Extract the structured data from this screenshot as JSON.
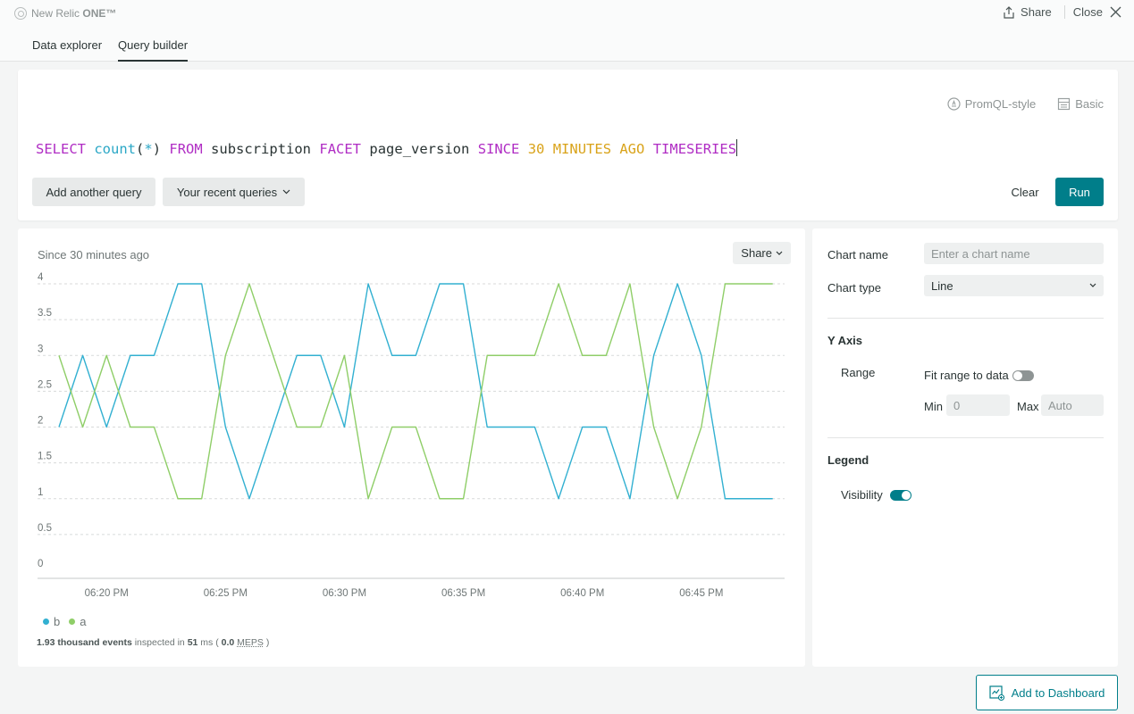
{
  "app": {
    "title": "New Relic ONE™",
    "title_plain": "New Relic ",
    "title_bold": "ONE™"
  },
  "top_actions": {
    "share": "Share",
    "close": "Close"
  },
  "tabs": [
    {
      "label": "Data explorer",
      "active": false
    },
    {
      "label": "Query builder",
      "active": true
    }
  ],
  "query": {
    "modes": [
      {
        "label": "PromQL-style",
        "icon": "promql-icon"
      },
      {
        "label": "Basic",
        "icon": "basic-icon"
      }
    ],
    "tokens": [
      {
        "text": "SELECT",
        "type": "kw"
      },
      {
        "text": " ",
        "type": "plain"
      },
      {
        "text": "count",
        "type": "fn"
      },
      {
        "text": "(",
        "type": "plain"
      },
      {
        "text": "*",
        "type": "fn"
      },
      {
        "text": ") ",
        "type": "plain"
      },
      {
        "text": "FROM",
        "type": "kw"
      },
      {
        "text": " subscription ",
        "type": "plain"
      },
      {
        "text": "FACET",
        "type": "kw"
      },
      {
        "text": " page_version ",
        "type": "plain"
      },
      {
        "text": "SINCE",
        "type": "kw"
      },
      {
        "text": " ",
        "type": "plain"
      },
      {
        "text": "30 MINUTES AGO",
        "type": "num"
      },
      {
        "text": " ",
        "type": "plain"
      },
      {
        "text": "TIMESERIES",
        "type": "kw"
      }
    ],
    "add_another": "Add another query",
    "recent": "Your recent queries",
    "clear": "Clear",
    "run": "Run"
  },
  "chart_panel": {
    "since_label": "Since 30 minutes ago",
    "share": "Share",
    "stats": {
      "count": "1.93 thousand events",
      "inspected_in": "inspected in",
      "ms": "51",
      "ms_unit": "ms (",
      "meps_val": "0.0",
      "meps": "MEPS",
      "close_paren": ")"
    }
  },
  "chart_data": {
    "type": "line",
    "title": "",
    "xlabel": "",
    "ylabel": "",
    "ylim": [
      0,
      4
    ],
    "y_ticks": [
      "0",
      "0.5",
      "1",
      "1.5",
      "2",
      "2.5",
      "3",
      "3.5",
      "4"
    ],
    "x_ticks": [
      "06:20 PM",
      "06:25 PM",
      "06:30 PM",
      "06:35 PM",
      "06:40 PM",
      "06:45 PM"
    ],
    "x_start_minute": 18,
    "x_end_minute": 48.5,
    "x_labels": [
      "06:18",
      "06:19",
      "06:20",
      "06:21",
      "06:22",
      "06:23",
      "06:24",
      "06:25",
      "06:26",
      "06:27",
      "06:28",
      "06:29",
      "06:30",
      "06:31",
      "06:32",
      "06:33",
      "06:34",
      "06:35",
      "06:36",
      "06:37",
      "06:38",
      "06:39",
      "06:40",
      "06:41",
      "06:42",
      "06:43",
      "06:44",
      "06:45",
      "06:46",
      "06:47",
      "06:48"
    ],
    "grid": true,
    "legend_position": "bottom-left",
    "series": [
      {
        "name": "b",
        "color": "#32b0d1",
        "values": [
          2,
          3,
          2,
          3,
          3,
          4,
          4,
          2,
          1,
          2,
          3,
          3,
          2,
          4,
          3,
          3,
          4,
          4,
          2,
          2,
          2,
          1,
          2,
          2,
          1,
          3,
          4,
          3,
          1,
          1,
          1
        ]
      },
      {
        "name": "a",
        "color": "#8fce68",
        "values": [
          3,
          2,
          3,
          2,
          2,
          1,
          1,
          3,
          4,
          3,
          2,
          2,
          3,
          1,
          2,
          2,
          1,
          1,
          3,
          3,
          3,
          4,
          3,
          3,
          4,
          2,
          1,
          2,
          4,
          4,
          4
        ]
      }
    ]
  },
  "settings": {
    "chart_name_label": "Chart name",
    "chart_name_placeholder": "Enter a chart name",
    "chart_type_label": "Chart type",
    "chart_type_value": "Line",
    "y_axis_heading": "Y Axis",
    "range_label": "Range",
    "fit_range_label": "Fit range to data",
    "fit_range_on": false,
    "min_label": "Min",
    "min_placeholder": "0",
    "max_label": "Max",
    "max_placeholder": "Auto",
    "legend_heading": "Legend",
    "visibility_label": "Visibility",
    "visibility_on": true
  },
  "footer": {
    "add_to_dashboard": "Add to Dashboard"
  }
}
